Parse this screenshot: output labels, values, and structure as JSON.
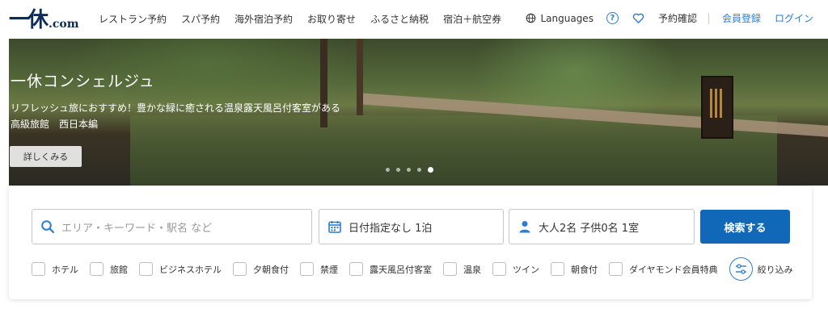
{
  "header": {
    "logo_mark": "一休",
    "logo_suffix": ".com",
    "nav": [
      "レストラン予約",
      "スパ予約",
      "海外宿泊予約",
      "お取り寄せ",
      "ふるさと納税",
      "宿泊＋航空券"
    ],
    "languages_label": "Languages",
    "help_icon": "?",
    "reservations_label": "予約確認",
    "register_label": "会員登録",
    "login_label": "ログイン"
  },
  "hero": {
    "title": "一休コンシェルジュ",
    "text": "リフレッシュ旅におすすめ！豊かな緑に癒される温泉露天風呂付客室がある高級旅館　西日本編",
    "button_label": "詳しくみる",
    "slide_count": 5,
    "active_slide": 5
  },
  "search": {
    "area_placeholder": "エリア・キーワード・駅名 など",
    "date_value": "日付指定なし 1泊",
    "guests_value": "大人2名  子供0名  1室",
    "submit_label": "検索する",
    "filters": [
      "ホテル",
      "旅館",
      "ビジネスホテル",
      "夕朝食付",
      "禁煙",
      "露天風呂付客室",
      "温泉",
      "ツイン",
      "朝食付",
      "ダイヤモンド会員特典"
    ],
    "narrow_label": "絞り込み"
  },
  "colors": {
    "accent_blue": "#2a7dd1",
    "button_blue": "#1268b8",
    "logo_navy": "#0c2b5a"
  }
}
